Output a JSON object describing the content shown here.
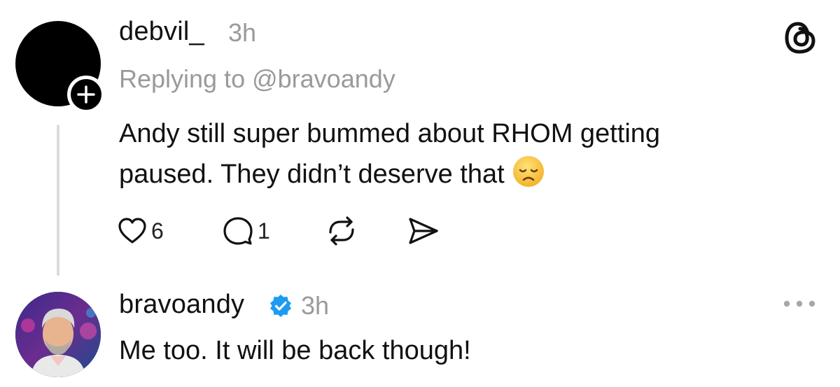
{
  "posts": [
    {
      "username": "debvil_",
      "time": "3h",
      "reply_to": "Replying to @bravoandy",
      "text_line1": "Andy still super bummed about RHOM getting",
      "text_line2": "paused. They didn’t deserve that",
      "emoji": "disappointed-face",
      "likes": "6",
      "replies": "1"
    },
    {
      "username": "bravoandy",
      "verified": true,
      "time": "3h",
      "text": "Me too.  It will be back though!"
    }
  ],
  "icons": {
    "app_logo": "threads-logo-icon",
    "follow": "plus-icon",
    "like": "heart-icon",
    "reply": "comment-icon",
    "repost": "repost-icon",
    "share": "send-icon",
    "more": "more-options-icon",
    "verified": "verified-badge-icon"
  },
  "colors": {
    "text": "#111111",
    "muted": "#9a9a9a",
    "thread_line": "#dcdcdc",
    "verified_blue": "#1d9bf0",
    "emoji_yellow": "#f7c23a"
  }
}
